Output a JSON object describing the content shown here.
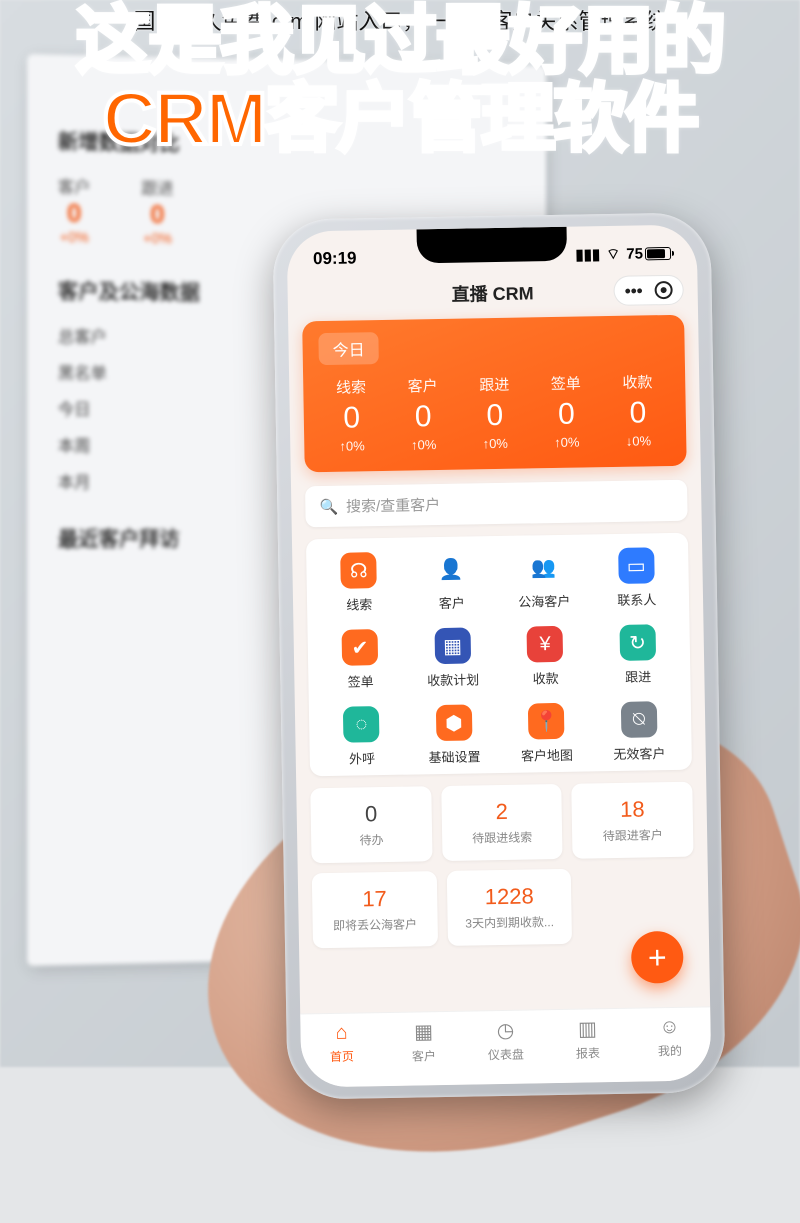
{
  "seo": "国内永久免费 crm 网站入口，一站式客户关系管理系统",
  "headline_l1": "这是我见过最好用的",
  "headline_l2": "CRM客户管理软件",
  "bg": {
    "section1": "新增数据对比",
    "kpis": [
      {
        "label": "客户",
        "num": "0",
        "pct": "+0%"
      },
      {
        "label": "跟进",
        "num": "0",
        "pct": "+0%"
      }
    ],
    "section2": "客户及公海数据",
    "list": [
      "总客户",
      "黑名单",
      "今日",
      "本周",
      "本月"
    ],
    "section3": "最近客户拜访"
  },
  "phone": {
    "status": {
      "time": "09:19",
      "battery": "75"
    },
    "title": "直播 CRM",
    "today": "今日",
    "stats": [
      {
        "label": "线索",
        "num": "0",
        "pct": "↑0%"
      },
      {
        "label": "客户",
        "num": "0",
        "pct": "↑0%"
      },
      {
        "label": "跟进",
        "num": "0",
        "pct": "↑0%"
      },
      {
        "label": "签单",
        "num": "0",
        "pct": "↑0%"
      },
      {
        "label": "收款",
        "num": "0",
        "pct": "↓0%"
      }
    ],
    "search_placeholder": "搜索/查重客户",
    "modules": [
      {
        "name": "线索",
        "icon": "☊",
        "cls": "ic-orange"
      },
      {
        "name": "客户",
        "icon": "👤",
        "cls": "ic-person"
      },
      {
        "name": "公海客户",
        "icon": "👥",
        "cls": "ic-person2"
      },
      {
        "name": "联系人",
        "icon": "▭",
        "cls": "ic-blue"
      },
      {
        "name": "签单",
        "icon": "✔",
        "cls": "ic-orange"
      },
      {
        "name": "收款计划",
        "icon": "▦",
        "cls": "ic-navy"
      },
      {
        "name": "收款",
        "icon": "¥",
        "cls": "ic-red"
      },
      {
        "name": "跟进",
        "icon": "↻",
        "cls": "ic-teal"
      },
      {
        "name": "外呼",
        "icon": "◌",
        "cls": "ic-teal"
      },
      {
        "name": "基础设置",
        "icon": "⬢",
        "cls": "ic-hex"
      },
      {
        "name": "客户地图",
        "icon": "📍",
        "cls": "ic-orange"
      },
      {
        "name": "无效客户",
        "icon": "⍉",
        "cls": "ic-gray"
      }
    ],
    "cards": [
      {
        "num": "0",
        "label": "待办",
        "gray": true
      },
      {
        "num": "2",
        "label": "待跟进线索"
      },
      {
        "num": "18",
        "label": "待跟进客户"
      },
      {
        "num": "17",
        "label": "即将丢公海客户"
      },
      {
        "num": "1228",
        "label": "3天内到期收款..."
      }
    ],
    "fab": "+",
    "tabs": [
      {
        "label": "首页",
        "icon": "⌂",
        "active": true
      },
      {
        "label": "客户",
        "icon": "▦"
      },
      {
        "label": "仪表盘",
        "icon": "◷"
      },
      {
        "label": "报表",
        "icon": "▥"
      },
      {
        "label": "我的",
        "icon": "☺"
      }
    ]
  }
}
